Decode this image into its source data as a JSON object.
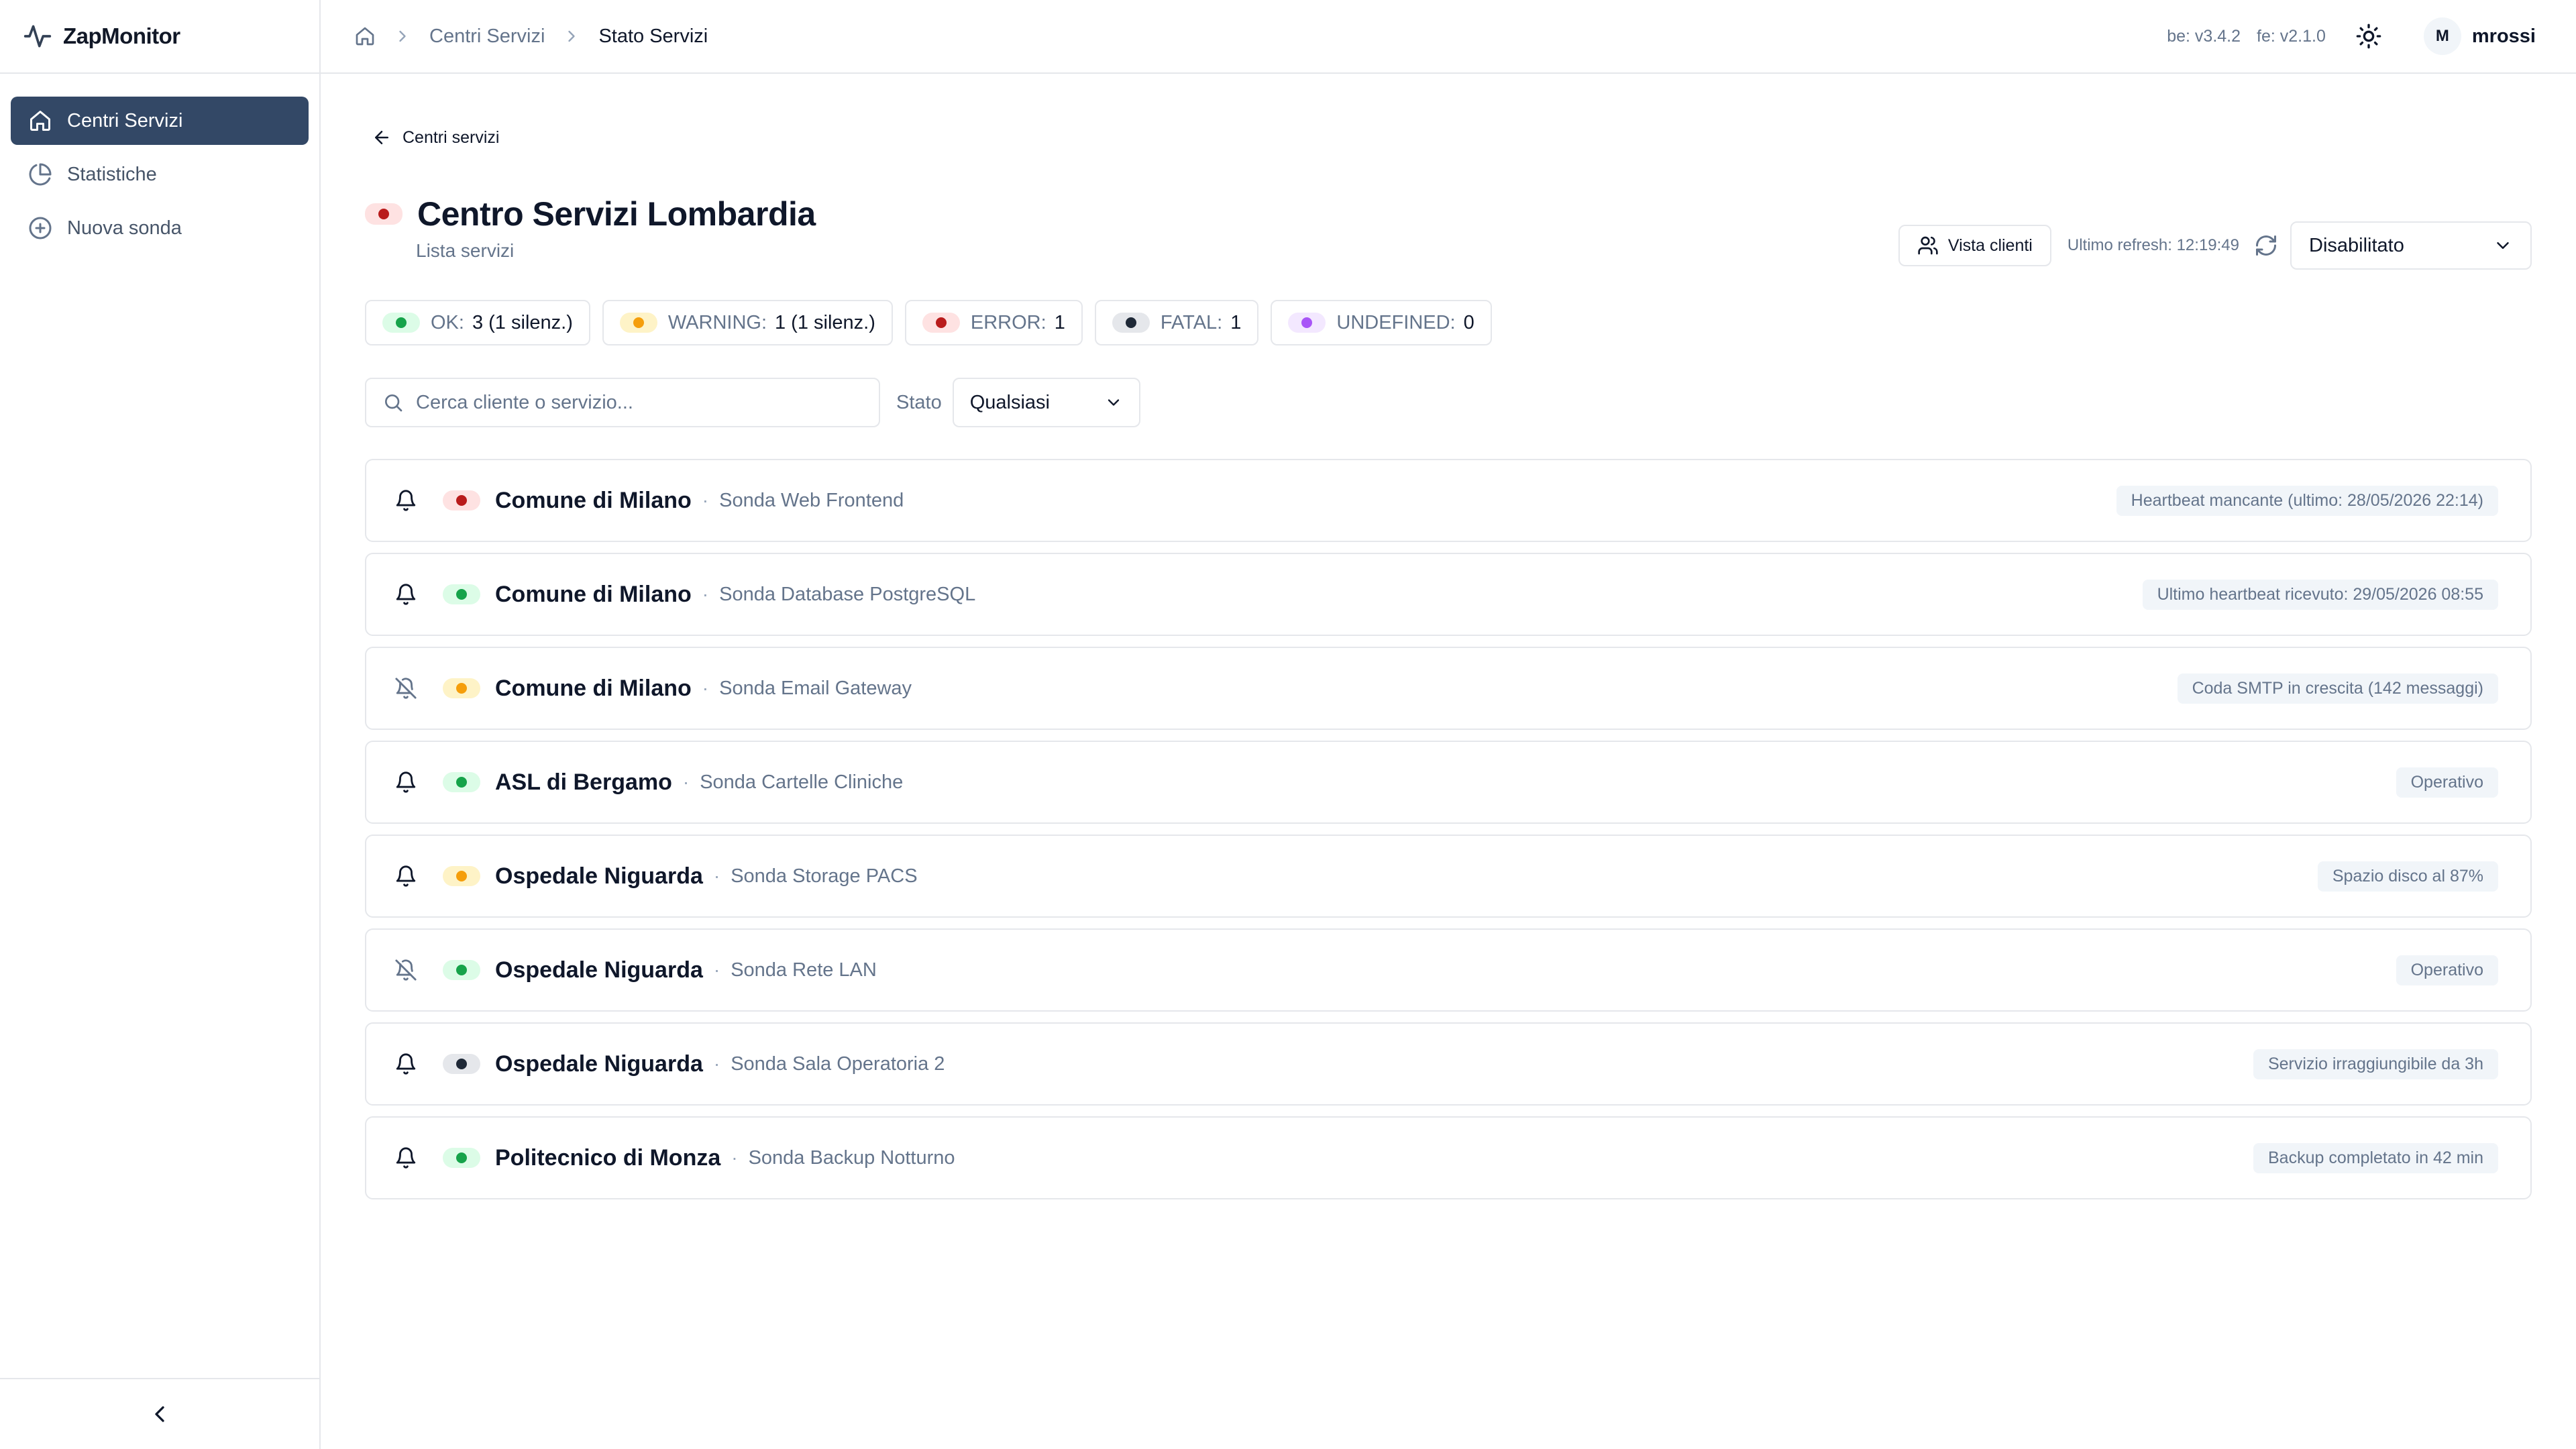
{
  "app": {
    "name": "ZapMonitor"
  },
  "sidebar": {
    "items": [
      {
        "label": "Centri Servizi",
        "icon": "home-icon",
        "active": true
      },
      {
        "label": "Statistiche",
        "icon": "pie-chart-icon",
        "active": false
      },
      {
        "label": "Nuova sonda",
        "icon": "plus-circle-icon",
        "active": false
      }
    ]
  },
  "header": {
    "breadcrumb": [
      "Centri Servizi",
      "Stato Servizi"
    ],
    "be_version": "be: v3.4.2",
    "fe_version": "fe: v2.1.0",
    "user": {
      "initial": "M",
      "name": "mrossi"
    }
  },
  "page": {
    "back_label": "Centri servizi",
    "title": "Centro Servizi Lombardia",
    "title_status": "error",
    "subtitle": "Lista servizi",
    "vista_clienti_label": "Vista clienti",
    "refresh_text": "Ultimo refresh: 12:19:49",
    "auto_refresh_value": "Disabilitato"
  },
  "status_counts": [
    {
      "status": "ok",
      "label": "OK:",
      "value": "3 (1 silenz.)"
    },
    {
      "status": "warning",
      "label": "WARNING:",
      "value": "1 (1 silenz.)"
    },
    {
      "status": "error",
      "label": "ERROR:",
      "value": "1"
    },
    {
      "status": "fatal",
      "label": "FATAL:",
      "value": "1"
    },
    {
      "status": "undefined",
      "label": "UNDEFINED:",
      "value": "0"
    }
  ],
  "filters": {
    "search_placeholder": "Cerca cliente o servizio...",
    "state_label": "Stato",
    "state_value": "Qualsiasi"
  },
  "services": [
    {
      "client": "Comune di Milano",
      "service": "Sonda Web Frontend",
      "status": "error",
      "silenced": false,
      "message": "Heartbeat mancante (ultimo: 28/05/2026 22:14)"
    },
    {
      "client": "Comune di Milano",
      "service": "Sonda Database PostgreSQL",
      "status": "ok",
      "silenced": false,
      "message": "Ultimo heartbeat ricevuto: 29/05/2026 08:55"
    },
    {
      "client": "Comune di Milano",
      "service": "Sonda Email Gateway",
      "status": "warning",
      "silenced": true,
      "message": "Coda SMTP in crescita (142 messaggi)"
    },
    {
      "client": "ASL di Bergamo",
      "service": "Sonda Cartelle Cliniche",
      "status": "ok",
      "silenced": false,
      "message": "Operativo"
    },
    {
      "client": "Ospedale Niguarda",
      "service": "Sonda Storage PACS",
      "status": "warning",
      "silenced": false,
      "message": "Spazio disco al 87%"
    },
    {
      "client": "Ospedale Niguarda",
      "service": "Sonda Rete LAN",
      "status": "ok",
      "silenced": true,
      "message": "Operativo"
    },
    {
      "client": "Ospedale Niguarda",
      "service": "Sonda Sala Operatoria 2",
      "status": "fatal",
      "silenced": false,
      "message": "Servizio irraggiungibile da 3h"
    },
    {
      "client": "Politecnico di Monza",
      "service": "Sonda Backup Notturno",
      "status": "ok",
      "silenced": false,
      "message": "Backup completato in 42 min"
    }
  ],
  "colors": {
    "sidebar_active_bg": "#334866",
    "ok": "#16a34a",
    "warning": "#f59e0b",
    "error": "#b91c1c",
    "fatal": "#1f2937",
    "undefined": "#a855f7"
  }
}
